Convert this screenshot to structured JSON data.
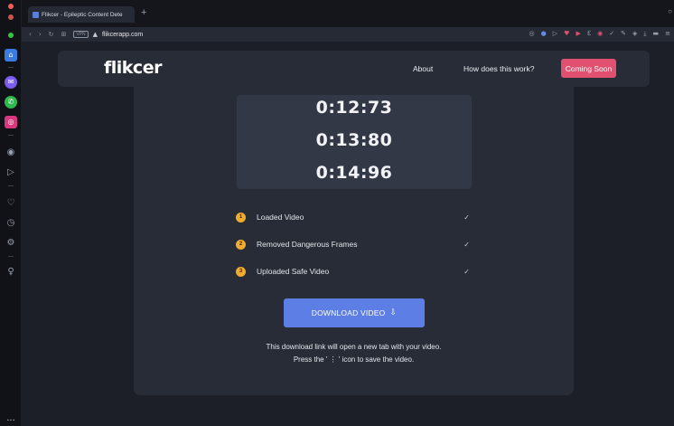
{
  "browser": {
    "tab_title": "Flikcer - Epileptic Content Dete",
    "new_tab_icon": "+",
    "url": "flikcerapp.com",
    "vpn_label": "VPN",
    "extension_icons": [
      "camera-icon",
      "shield-icon",
      "play-icon",
      "heart-icon",
      "flikcer-ext-icon",
      "logo-ext-icon",
      "circle-icon",
      "check-icon",
      "pen-icon",
      "cube-icon",
      "download-icon",
      "battery-icon",
      "menu-icon"
    ]
  },
  "sidebar": {
    "icons": [
      "home-icon",
      "messenger-icon",
      "whatsapp-icon",
      "instagram-icon",
      "music-icon",
      "send-icon",
      "heart-icon",
      "history-icon",
      "settings-icon",
      "bulb-icon"
    ],
    "more": "..."
  },
  "navbar": {
    "logo": "flikcer",
    "links": [
      "About",
      "How does this work?"
    ],
    "cta": "Coming Soon"
  },
  "timers": [
    "0:12:73",
    "0:13:80",
    "0:14:96"
  ],
  "steps": [
    {
      "num": "1",
      "label": "Loaded Video"
    },
    {
      "num": "2",
      "label": "Removed Dangerous Frames"
    },
    {
      "num": "3",
      "label": "Uploaded Safe Video"
    }
  ],
  "download": {
    "label": "DOWNLOAD VIDEO"
  },
  "note": {
    "line1": "This download link will open a new tab with your video.",
    "line2": "Press the ' ⋮ ' icon to save the video."
  },
  "colors": {
    "accent": "#5d7ee4",
    "cta": "#e2506f",
    "step_badge": "#f1ac2f"
  }
}
